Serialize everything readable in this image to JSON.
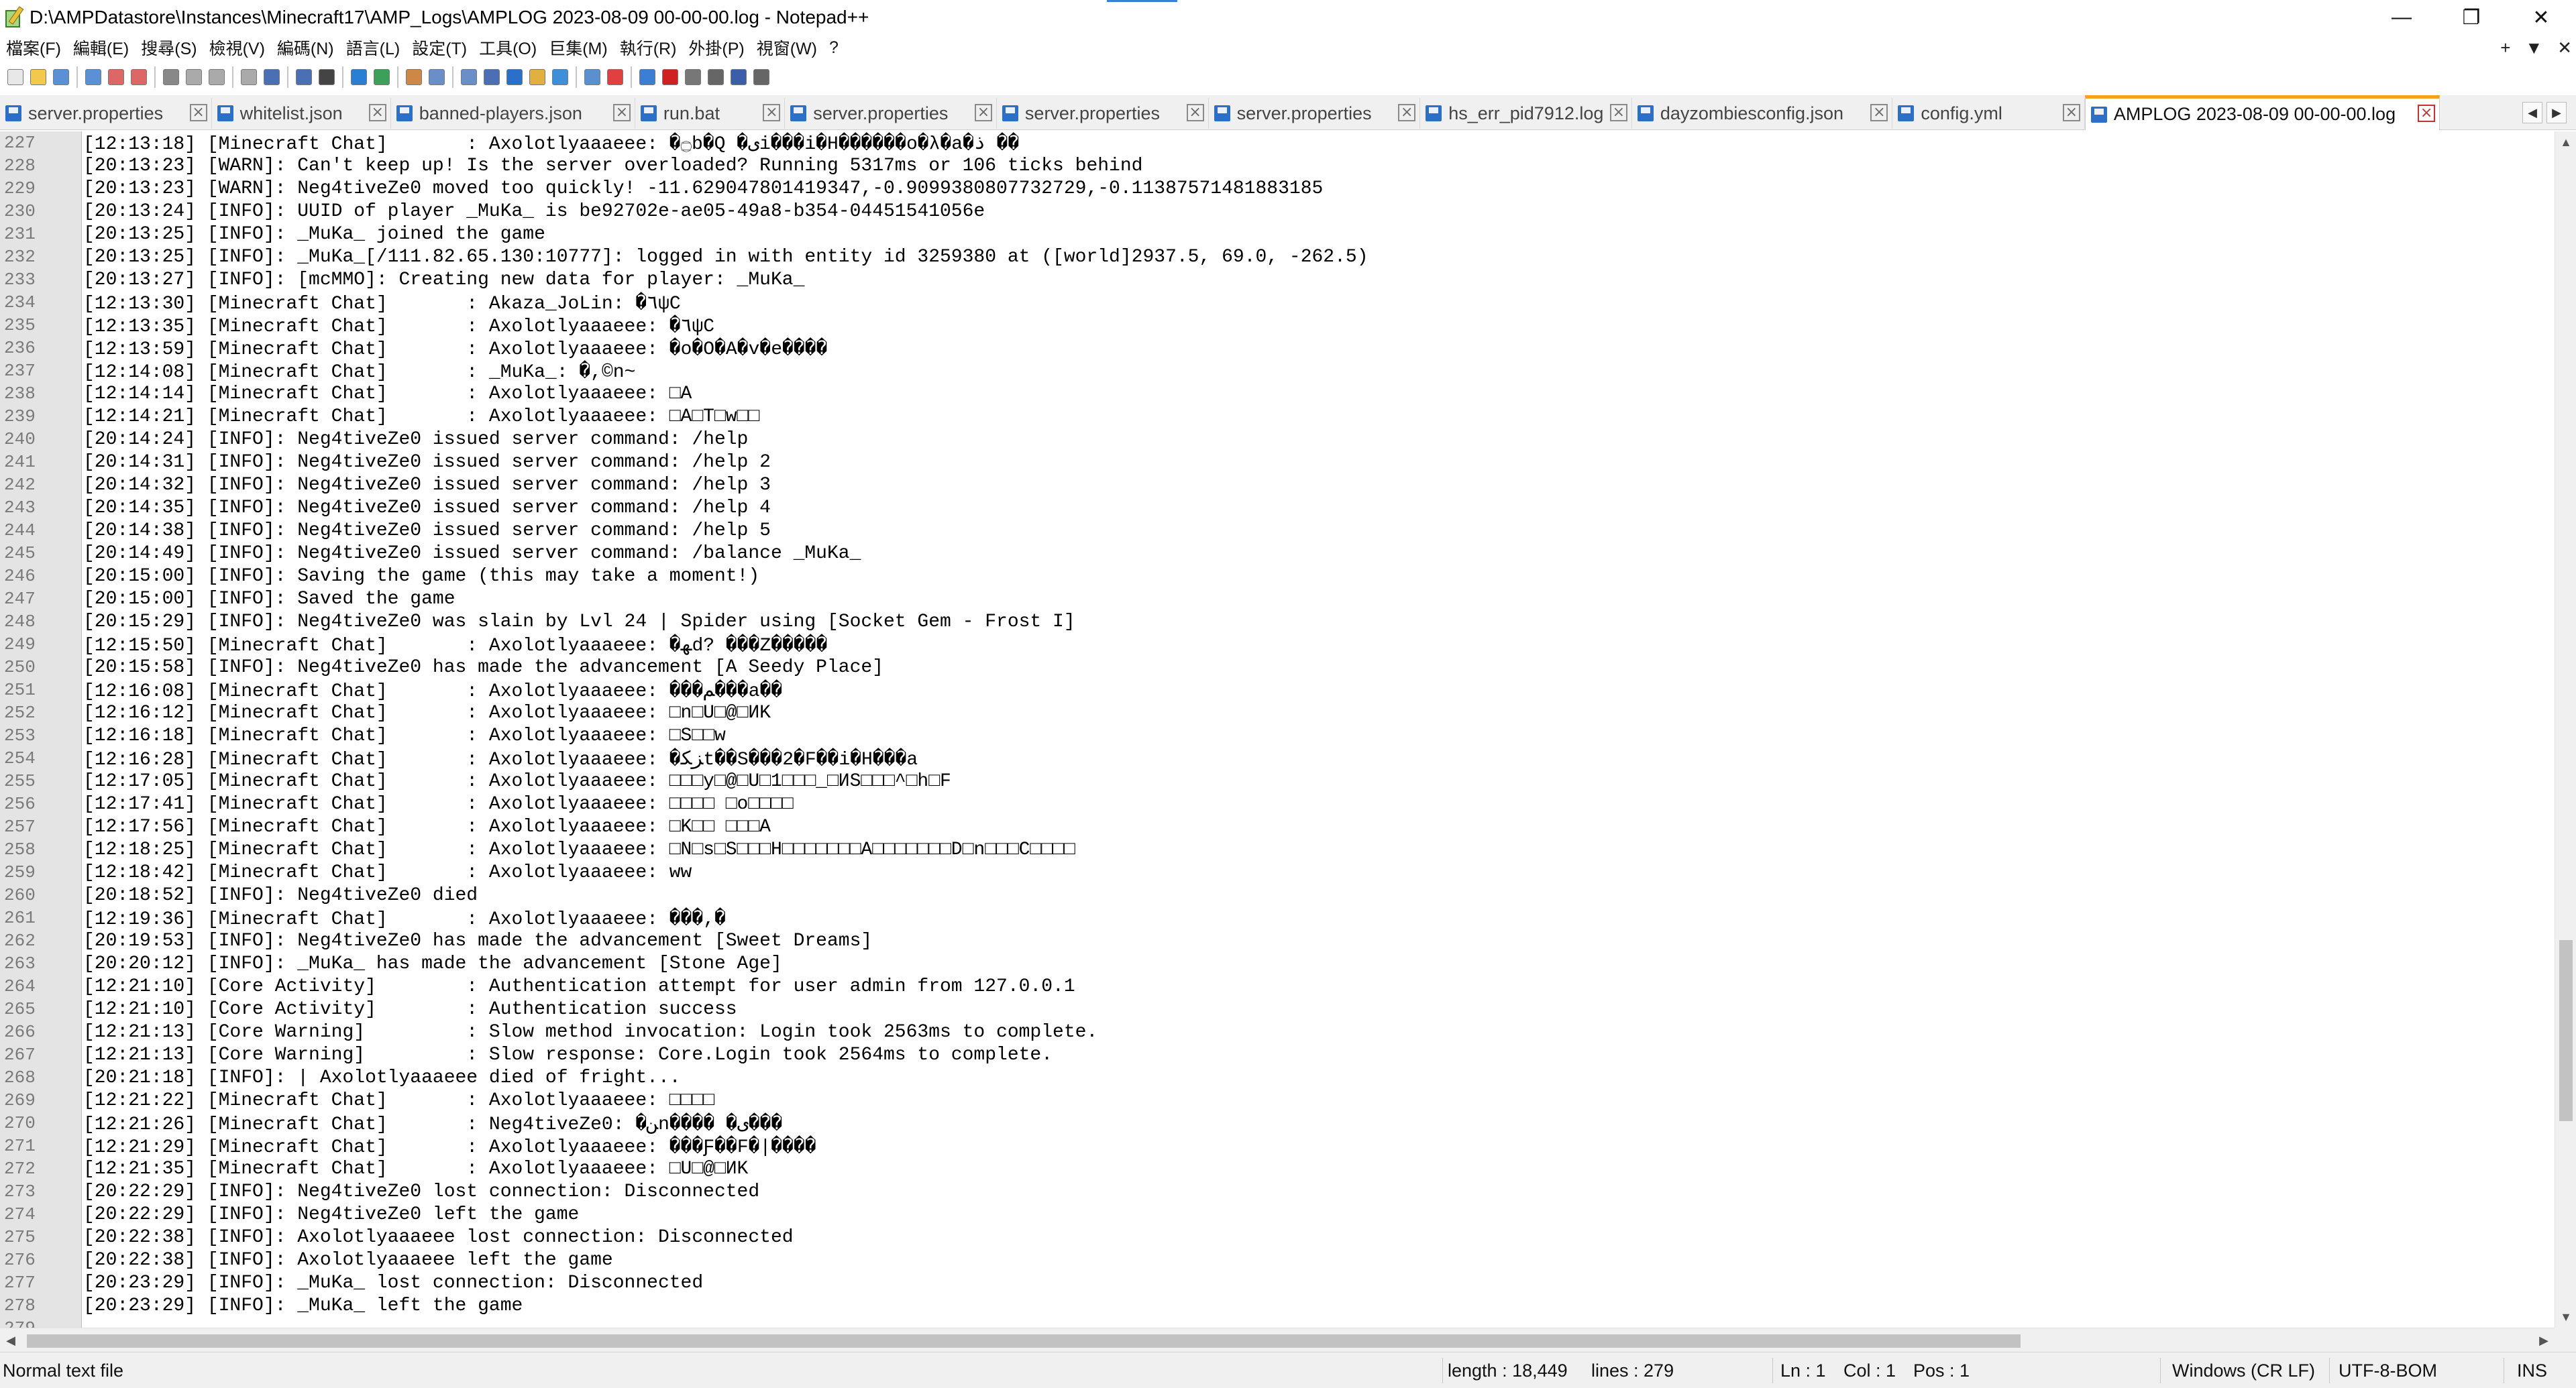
{
  "window": {
    "title": "D:\\AMPDatastore\\Instances\\Minecraft17\\AMP_Logs\\AMPLOG 2023-08-09 00-00-00.log - Notepad++",
    "minimize": "—",
    "maximize": "❐",
    "close": "✕"
  },
  "menu": {
    "items": [
      "檔案(F)",
      "編輯(E)",
      "搜尋(S)",
      "檢視(V)",
      "編碼(N)",
      "語言(L)",
      "設定(T)",
      "工具(O)",
      "巨集(M)",
      "執行(R)",
      "外掛(P)",
      "視窗(W)",
      "?"
    ],
    "right_plus": "+",
    "right_dropdown": "▼",
    "right_close": "✕"
  },
  "tabs": [
    {
      "label": "server.properties",
      "active": false
    },
    {
      "label": "whitelist.json",
      "active": false
    },
    {
      "label": "banned-players.json",
      "active": false
    },
    {
      "label": "run.bat",
      "active": false
    },
    {
      "label": "server.properties",
      "active": false
    },
    {
      "label": "server.properties",
      "active": false
    },
    {
      "label": "server.properties",
      "active": false
    },
    {
      "label": "hs_err_pid7912.log",
      "active": false
    },
    {
      "label": "dayzombiesconfig.json",
      "active": false
    },
    {
      "label": "config.yml",
      "active": false
    },
    {
      "label": "AMPLOG 2023-08-09 00-00-00.log",
      "active": true
    }
  ],
  "tab_nav": {
    "left": "◀",
    "right": "▶"
  },
  "editor": {
    "lines": [
      {
        "n": "227",
        "t": "[12:13:18] [Minecraft Chat]       : Axolotlyaaaeee: �۝b�Q �یi���i�H������o�λ�a�ذ ��"
      },
      {
        "n": "228",
        "t": "[20:13:23] [WARN]: Can't keep up! Is the server overloaded? Running 5317ms or 106 ticks behind"
      },
      {
        "n": "229",
        "t": "[20:13:23] [WARN]: Neg4tiveZe0 moved too quickly! -11.629047801419347,-0.9099380807732729,-0.11387571481883185"
      },
      {
        "n": "230",
        "t": "[20:13:24] [INFO]: UUID of player _MuKa_ is be92702e-ae05-49a8-b354-04451541056e"
      },
      {
        "n": "231",
        "t": "[20:13:25] [INFO]: _MuKa_ joined the game"
      },
      {
        "n": "232",
        "t": "[20:13:25] [INFO]: _MuKa_[/111.82.65.130:10777]: logged in with entity id 3259380 at ([world]2937.5, 69.0, -262.5)"
      },
      {
        "n": "233",
        "t": "[20:13:27] [INFO]: [mcMMO]: Creating new data for player: _MuKa_"
      },
      {
        "n": "234",
        "t": "[12:13:30] [Minecraft Chat]       : Akaza_JoLin: �٦ψC"
      },
      {
        "n": "235",
        "t": "[12:13:35] [Minecraft Chat]       : Axolotlyaaaeee: �٦ψC"
      },
      {
        "n": "236",
        "t": "[12:13:59] [Minecraft Chat]       : Axolotlyaaaeee: �o�O�A�v�e����"
      },
      {
        "n": "237",
        "t": "[12:14:08] [Minecraft Chat]       : _MuKa_: �,©n~"
      },
      {
        "n": "238",
        "t": "[12:14:14] [Minecraft Chat]       : Axolotlyaaaeee: □A"
      },
      {
        "n": "239",
        "t": "[12:14:21] [Minecraft Chat]       : Axolotlyaaaeee: □A□T□w□□"
      },
      {
        "n": "240",
        "t": "[20:14:24] [INFO]: Neg4tiveZe0 issued server command: /help"
      },
      {
        "n": "241",
        "t": "[20:14:31] [INFO]: Neg4tiveZe0 issued server command: /help 2"
      },
      {
        "n": "242",
        "t": "[20:14:32] [INFO]: Neg4tiveZe0 issued server command: /help 3"
      },
      {
        "n": "243",
        "t": "[20:14:35] [INFO]: Neg4tiveZe0 issued server command: /help 4"
      },
      {
        "n": "244",
        "t": "[20:14:38] [INFO]: Neg4tiveZe0 issued server command: /help 5"
      },
      {
        "n": "245",
        "t": "[20:14:49] [INFO]: Neg4tiveZe0 issued server command: /balance _MuKa_"
      },
      {
        "n": "246",
        "t": "[20:15:00] [INFO]: Saving the game (this may take a moment!)"
      },
      {
        "n": "247",
        "t": "[20:15:00] [INFO]: Saved the game"
      },
      {
        "n": "248",
        "t": "[20:15:29] [INFO]: Neg4tiveZe0 was slain by Lvl 24 | Spider using [Socket Gem - Frost I]"
      },
      {
        "n": "249",
        "t": "[12:15:50] [Minecraft Chat]       : Axolotlyaaaeee: �ﻬd? ���Z�����"
      },
      {
        "n": "250",
        "t": "[20:15:58] [INFO]: Neg4tiveZe0 has made the advancement [A Seedy Place]"
      },
      {
        "n": "251",
        "t": "[12:16:08] [Minecraft Chat]       : Axolotlyaaaeee: ���ﻢ���a��"
      },
      {
        "n": "252",
        "t": "[12:16:12] [Minecraft Chat]       : Axolotlyaaaeee: □n□U□@□ИK"
      },
      {
        "n": "253",
        "t": "[12:16:18] [Minecraft Chat]       : Axolotlyaaaeee: □S□□w"
      },
      {
        "n": "254",
        "t": "[12:16:28] [Minecraft Chat]       : Axolotlyaaaeee: �ﺰﻜt��S���2�F��i�H���a"
      },
      {
        "n": "255",
        "t": "[12:17:05] [Minecraft Chat]       : Axolotlyaaaeee: □□□y□@□U□1□□□_□ИS□□□^□h□F"
      },
      {
        "n": "256",
        "t": "[12:17:41] [Minecraft Chat]       : Axolotlyaaaeee: □□□□ □o□□□□"
      },
      {
        "n": "257",
        "t": "[12:17:56] [Minecraft Chat]       : Axolotlyaaaeee: □K□□ □□□A"
      },
      {
        "n": "258",
        "t": "[12:18:25] [Minecraft Chat]       : Axolotlyaaaeee: □N□s□S□□□H□□□□□□□A□□□□□□□D□n□□□C□□□□"
      },
      {
        "n": "259",
        "t": "[12:18:42] [Minecraft Chat]       : Axolotlyaaaeee: ww"
      },
      {
        "n": "260",
        "t": "[20:18:52] [INFO]: Neg4tiveZe0 died"
      },
      {
        "n": "261",
        "t": "[12:19:36] [Minecraft Chat]       : Axolotlyaaaeee: ���,�"
      },
      {
        "n": "262",
        "t": "[20:19:53] [INFO]: Neg4tiveZe0 has made the advancement [Sweet Dreams]"
      },
      {
        "n": "263",
        "t": "[20:20:12] [INFO]: _MuKa_ has made the advancement [Stone Age]"
      },
      {
        "n": "264",
        "t": "[12:21:10] [Core Activity]        : Authentication attempt for user admin from 127.0.0.1"
      },
      {
        "n": "265",
        "t": "[12:21:10] [Core Activity]        : Authentication success"
      },
      {
        "n": "266",
        "t": "[12:21:13] [Core Warning]         : Slow method invocation: Login took 2563ms to complete."
      },
      {
        "n": "267",
        "t": "[12:21:13] [Core Warning]         : Slow response: Core.Login took 2564ms to complete."
      },
      {
        "n": "268",
        "t": "[20:21:18] [INFO]: | Axolotlyaaaeee died of fright..."
      },
      {
        "n": "269",
        "t": "[12:21:22] [Minecraft Chat]       : Axolotlyaaaeee: □□□□"
      },
      {
        "n": "270",
        "t": "[12:21:26] [Minecraft Chat]       : Neg4tiveZe0: �ﻦn���� �ﻯ���"
      },
      {
        "n": "271",
        "t": "[12:21:29] [Minecraft Chat]       : Axolotlyaaaeee: ���Ƒ��F�|����"
      },
      {
        "n": "272",
        "t": "[12:21:35] [Minecraft Chat]       : Axolotlyaaaeee: □U□@□ИK"
      },
      {
        "n": "273",
        "t": "[20:22:29] [INFO]: Neg4tiveZe0 lost connection: Disconnected"
      },
      {
        "n": "274",
        "t": "[20:22:29] [INFO]: Neg4tiveZe0 left the game"
      },
      {
        "n": "275",
        "t": "[20:22:38] [INFO]: Axolotlyaaaeee lost connection: Disconnected"
      },
      {
        "n": "276",
        "t": "[20:22:38] [INFO]: Axolotlyaaaeee left the game"
      },
      {
        "n": "277",
        "t": "[20:23:29] [INFO]: _MuKa_ lost connection: Disconnected"
      },
      {
        "n": "278",
        "t": "[20:23:29] [INFO]: _MuKa_ left the game"
      },
      {
        "n": "279",
        "t": ""
      }
    ]
  },
  "scroll": {
    "up": "▲",
    "down": "▼",
    "left": "◀",
    "right": "▶"
  },
  "status": {
    "file_type": "Normal text file",
    "length": "length : 18,449",
    "lines": "lines : 279",
    "ln": "Ln : 1",
    "col": "Col : 1",
    "pos": "Pos : 1",
    "eol": "Windows (CR LF)",
    "encoding": "UTF-8-BOM",
    "mode": "INS"
  },
  "colors": {
    "active_tab_accent": "#f6a11e",
    "active_tab_close": "#c73232",
    "file_icon": "#2b6fc7"
  },
  "toolbar_icons": [
    "new-file-icon",
    "open-file-icon",
    "save-icon",
    "save-all-icon",
    "close-icon",
    "close-all-icon",
    "print-icon",
    "cut-icon",
    "copy-icon",
    "paste-icon",
    "undo-icon",
    "redo-icon",
    "find-icon",
    "replace-icon",
    "zoom-in-icon",
    "zoom-out-icon",
    "sync-vertical-icon",
    "sync-horizontal-icon",
    "word-wrap-icon",
    "show-all-chars-icon",
    "indent-guide-icon",
    "doc-map-icon",
    "function-list-icon",
    "folder-as-workspace-icon",
    "monitoring-icon",
    "record-macro-icon",
    "stop-macro-icon",
    "play-macro-icon",
    "run-macro-multiple-icon",
    "save-macro-icon"
  ]
}
